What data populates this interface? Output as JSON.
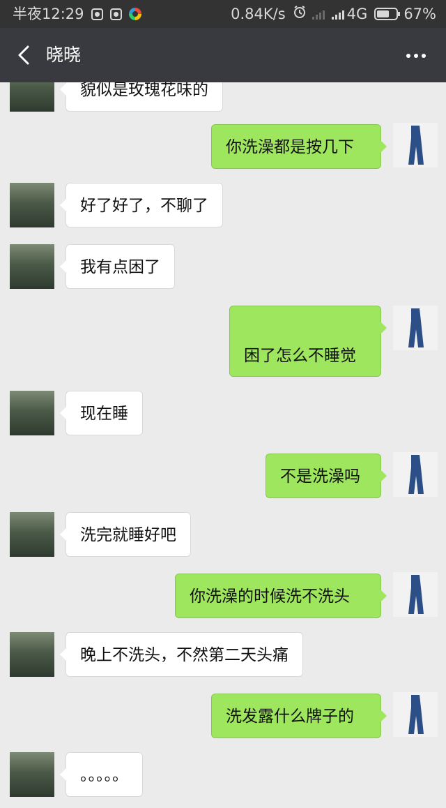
{
  "status_bar": {
    "time": "半夜12:29",
    "network_speed": "0.84K/s",
    "network_type": "4G",
    "battery": "67%",
    "battery_level": 0.67,
    "icons": [
      "app-notification-icon",
      "app-notification-icon",
      "browser-wheel-icon",
      "alarm-clock-icon",
      "signal-icon",
      "battery-icon"
    ]
  },
  "header": {
    "title": "晓晓",
    "back_icon": "chevron-left-icon",
    "more_icon": "more-dots-icon"
  },
  "colors": {
    "header_bg": "#393a3f",
    "status_bg": "#333333",
    "chat_bg": "#ebebeb",
    "self_bubble": "#9fe65f",
    "friend_bubble": "#ffffff"
  },
  "messages": [
    {
      "sender": "friend",
      "text": "貌似是玫瑰花味的"
    },
    {
      "sender": "self",
      "text": "你洗澡都是按几下"
    },
    {
      "sender": "friend",
      "text": "好了好了，不聊了"
    },
    {
      "sender": "friend",
      "text": "我有点困了"
    },
    {
      "sender": "self",
      "text": "困了怎么不睡觉"
    },
    {
      "sender": "friend",
      "text": "现在睡"
    },
    {
      "sender": "self",
      "text": "不是洗澡吗"
    },
    {
      "sender": "friend",
      "text": "洗完就睡好吧"
    },
    {
      "sender": "self",
      "text": "你洗澡的时候洗不洗头"
    },
    {
      "sender": "friend",
      "text": "晚上不洗头，不然第二天头痛"
    },
    {
      "sender": "self",
      "text": "洗发露什么牌子的"
    },
    {
      "sender": "friend",
      "text": "。。。。。"
    }
  ]
}
